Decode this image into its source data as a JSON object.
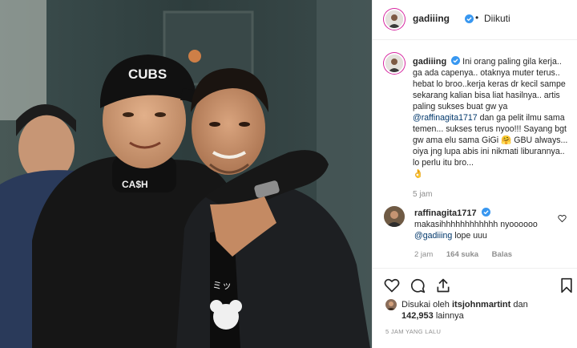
{
  "post": {
    "author": "gadiiing",
    "follow_dot": "•",
    "follow_label": "Diikuti"
  },
  "caption": {
    "username": "gadiiing",
    "text_before_mention": "Ini orang paling gila kerja.. ga ada capenya.. otaknya muter terus.. hebat lo broo..kerja keras dr kecil sampe sekarang kalian bisa liat hasilnya.. artis paling sukses buat gw ya ",
    "mention": "@raffinagita1717",
    "text_after_mention": " dan ga pelit ilmu sama temen... sukses terus nyoo!!! Sayang bgt gw ama elu sama GiGi ",
    "text_end": " GBU always... oiya jng lupa abis ini nikmati liburannya.. lo perlu itu bro...",
    "emoji_1": "🤗",
    "emoji_2": "👌",
    "time": "5 jam"
  },
  "comment": {
    "username": "raffinagita1717",
    "text": "makasihhhhhhhhhhhh nyoooooo",
    "mention": "@gadiiing",
    "text_after": " lope uuu",
    "time": "2 jam",
    "likes": "164 suka",
    "reply": "Balas"
  },
  "likes": {
    "prefix": "Disukai oleh ",
    "user": "itsjohnmartint",
    "conj": " dan",
    "count": "142,953",
    "suffix": " lainnya"
  },
  "posted_ago": "5 JAM YANG LALU",
  "icons": [
    "heart-icon",
    "comment-icon",
    "share-icon",
    "bookmark-icon",
    "verified-icon",
    "heart-small-icon"
  ],
  "colors": {
    "mention": "#00376b",
    "verified": "#3897f0",
    "muted": "#8e8e8e",
    "photo_bg": "#2f3e3d"
  },
  "photo": {
    "cap_text": "CUBS",
    "collar_text": "CA$H"
  }
}
